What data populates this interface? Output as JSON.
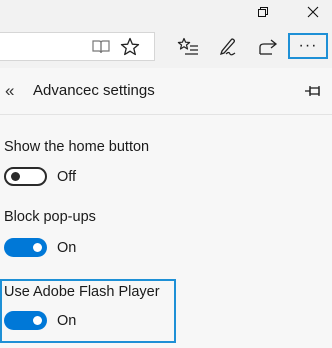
{
  "window": {
    "restore_glyph": "❐",
    "close_glyph": "✕"
  },
  "toolbar": {
    "more_label": "···",
    "icons": [
      "reading-view-icon",
      "favorite-star-icon",
      "favorites-hub-icon",
      "web-note-icon",
      "share-icon",
      "more-icon"
    ]
  },
  "pane": {
    "back_glyph": "«",
    "title": "Advancec settings"
  },
  "settings": [
    {
      "label": "Show the home button",
      "state": "Off",
      "on": false
    },
    {
      "label": "Block pop-ups",
      "state": "On",
      "on": true
    },
    {
      "label": "Use Adobe Flash Player",
      "state": "On",
      "on": true
    }
  ],
  "colors": {
    "accent": "#0078d7",
    "highlight": "#1e90d6"
  }
}
